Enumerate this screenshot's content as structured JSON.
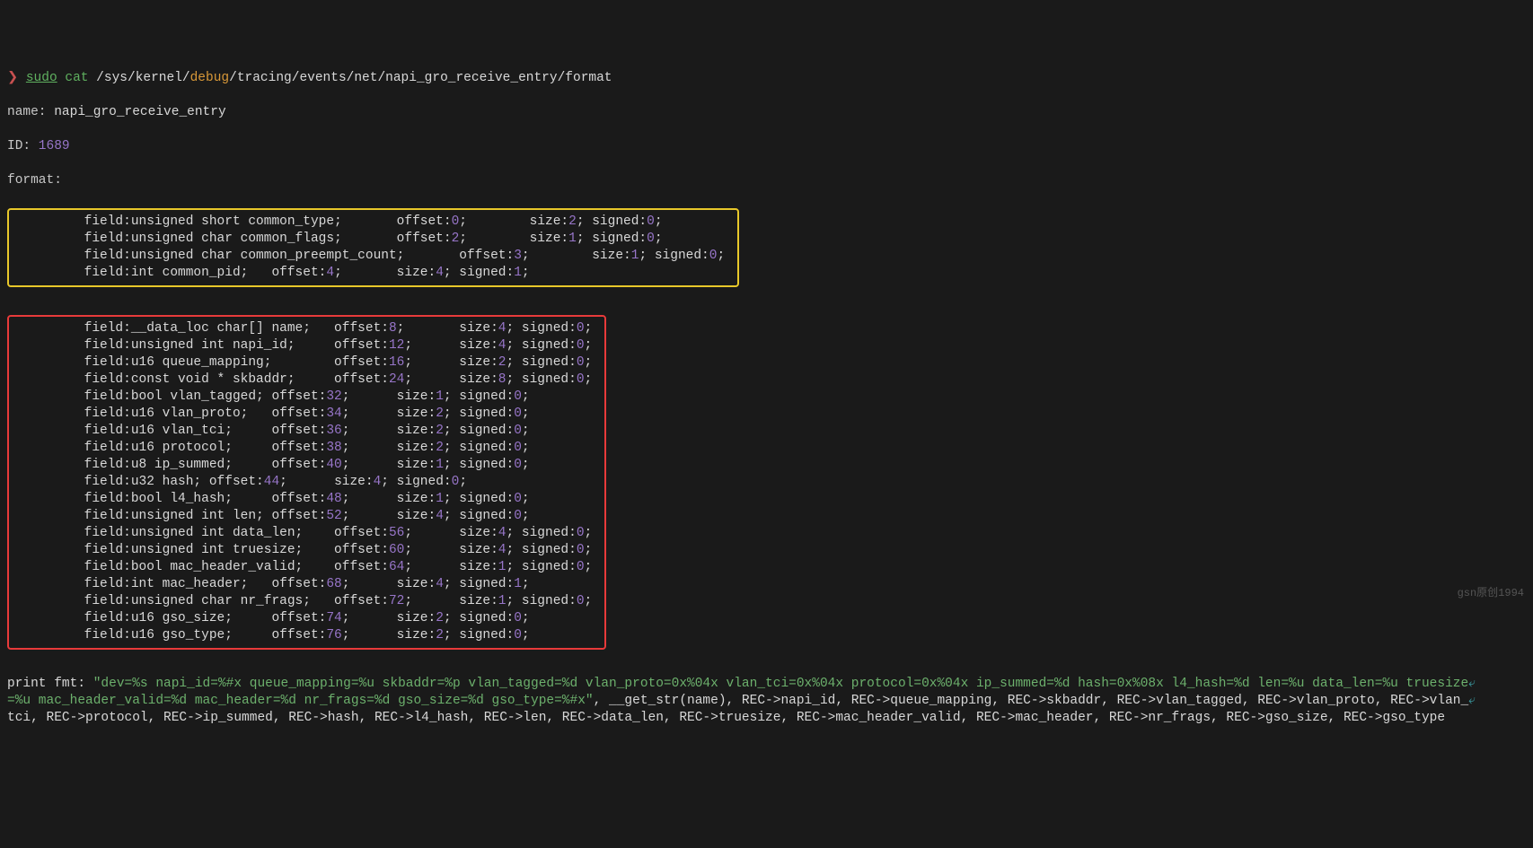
{
  "prompt": {
    "symbol": "❯",
    "cmd1": "sudo",
    "cmd2": "cat",
    "path_pre": " /sys/kernel/",
    "path_debug": "debug",
    "path_post": "/tracing/events/net/napi_gro_receive_entry/format"
  },
  "header": {
    "name_label": "name:",
    "name_val": " napi_gro_receive_entry",
    "id_label": "ID:",
    "id_val": " 1689",
    "format_label": "format:"
  },
  "common": [
    {
      "pre": "        field:unsigned short common_type;       offset:",
      "off": "0",
      "mid": ";        size:",
      "sz": "2",
      "mid2": "; signed:",
      "sg": "0",
      "end": ";"
    },
    {
      "pre": "        field:unsigned char common_flags;       offset:",
      "off": "2",
      "mid": ";        size:",
      "sz": "1",
      "mid2": "; signed:",
      "sg": "0",
      "end": ";"
    },
    {
      "pre": "        field:unsigned char common_preempt_count;       offset:",
      "off": "3",
      "mid": ";        size:",
      "sz": "1",
      "mid2": "; signed:",
      "sg": "0",
      "end": ";"
    },
    {
      "pre": "        field:int common_pid;   offset:",
      "off": "4",
      "mid": ";       size:",
      "sz": "4",
      "mid2": "; signed:",
      "sg": "1",
      "end": ";"
    }
  ],
  "fields": [
    {
      "pre": "        field:__data_loc char[] name;   offset:",
      "off": "8",
      "mid": ";       size:",
      "sz": "4",
      "mid2": "; signed:",
      "sg": "0",
      "end": ";"
    },
    {
      "pre": "        field:unsigned int napi_id;     offset:",
      "off": "12",
      "mid": ";      size:",
      "sz": "4",
      "mid2": "; signed:",
      "sg": "0",
      "end": ";"
    },
    {
      "pre": "        field:u16 queue_mapping;        offset:",
      "off": "16",
      "mid": ";      size:",
      "sz": "2",
      "mid2": "; signed:",
      "sg": "0",
      "end": ";"
    },
    {
      "pre": "        field:const void * skbaddr;     offset:",
      "off": "24",
      "mid": ";      size:",
      "sz": "8",
      "mid2": "; signed:",
      "sg": "0",
      "end": ";"
    },
    {
      "pre": "        field:bool vlan_tagged; offset:",
      "off": "32",
      "mid": ";      size:",
      "sz": "1",
      "mid2": "; signed:",
      "sg": "0",
      "end": ";"
    },
    {
      "pre": "        field:u16 vlan_proto;   offset:",
      "off": "34",
      "mid": ";      size:",
      "sz": "2",
      "mid2": "; signed:",
      "sg": "0",
      "end": ";"
    },
    {
      "pre": "        field:u16 vlan_tci;     offset:",
      "off": "36",
      "mid": ";      size:",
      "sz": "2",
      "mid2": "; signed:",
      "sg": "0",
      "end": ";"
    },
    {
      "pre": "        field:u16 protocol;     offset:",
      "off": "38",
      "mid": ";      size:",
      "sz": "2",
      "mid2": "; signed:",
      "sg": "0",
      "end": ";"
    },
    {
      "pre": "        field:u8 ip_summed;     offset:",
      "off": "40",
      "mid": ";      size:",
      "sz": "1",
      "mid2": "; signed:",
      "sg": "0",
      "end": ";"
    },
    {
      "pre": "        field:u32 hash; offset:",
      "off": "44",
      "mid": ";      size:",
      "sz": "4",
      "mid2": "; signed:",
      "sg": "0",
      "end": ";"
    },
    {
      "pre": "        field:bool l4_hash;     offset:",
      "off": "48",
      "mid": ";      size:",
      "sz": "1",
      "mid2": "; signed:",
      "sg": "0",
      "end": ";"
    },
    {
      "pre": "        field:unsigned int len; offset:",
      "off": "52",
      "mid": ";      size:",
      "sz": "4",
      "mid2": "; signed:",
      "sg": "0",
      "end": ";"
    },
    {
      "pre": "        field:unsigned int data_len;    offset:",
      "off": "56",
      "mid": ";      size:",
      "sz": "4",
      "mid2": "; signed:",
      "sg": "0",
      "end": ";"
    },
    {
      "pre": "        field:unsigned int truesize;    offset:",
      "off": "60",
      "mid": ";      size:",
      "sz": "4",
      "mid2": "; signed:",
      "sg": "0",
      "end": ";"
    },
    {
      "pre": "        field:bool mac_header_valid;    offset:",
      "off": "64",
      "mid": ";      size:",
      "sz": "1",
      "mid2": "; signed:",
      "sg": "0",
      "end": ";"
    },
    {
      "pre": "        field:int mac_header;   offset:",
      "off": "68",
      "mid": ";      size:",
      "sz": "4",
      "mid2": "; signed:",
      "sg": "1",
      "end": ";"
    },
    {
      "pre": "        field:unsigned char nr_frags;   offset:",
      "off": "72",
      "mid": ";      size:",
      "sz": "1",
      "mid2": "; signed:",
      "sg": "0",
      "end": ";"
    },
    {
      "pre": "        field:u16 gso_size;     offset:",
      "off": "74",
      "mid": ";      size:",
      "sz": "2",
      "mid2": "; signed:",
      "sg": "0",
      "end": ";"
    },
    {
      "pre": "        field:u16 gso_type;     offset:",
      "off": "76",
      "mid": ";      size:",
      "sz": "2",
      "mid2": "; signed:",
      "sg": "0",
      "end": ";"
    }
  ],
  "printfmt": {
    "label": "print fmt: ",
    "str1": "\"dev=%s napi_id=%#x queue_mapping=%u skbaddr=%p vlan_tagged=%d vlan_proto=0x%04x vlan_tci=0x%04x protocol=0x%04x ip_summed=%d hash=0x%08x l4_hash=%d len=%u data_len=%u truesize",
    "wrap1": "⤶",
    "str2": "=%u mac_header_valid=%d mac_header=%d nr_frags=%d gso_size=%d gso_type=%#x\"",
    "post": ", __get_str(name), REC->napi_id, REC->queue_mapping, REC->skbaddr, REC->vlan_tagged, REC->vlan_proto, REC->vlan_",
    "wrap2": "⤶",
    "post2": "tci, REC->protocol, REC->ip_summed, REC->hash, REC->l4_hash, REC->len, REC->data_len, REC->truesize, REC->mac_header_valid, REC->mac_header, REC->nr_frags, REC->gso_size, REC->gso_type"
  },
  "watermark": "gsn原创1994"
}
